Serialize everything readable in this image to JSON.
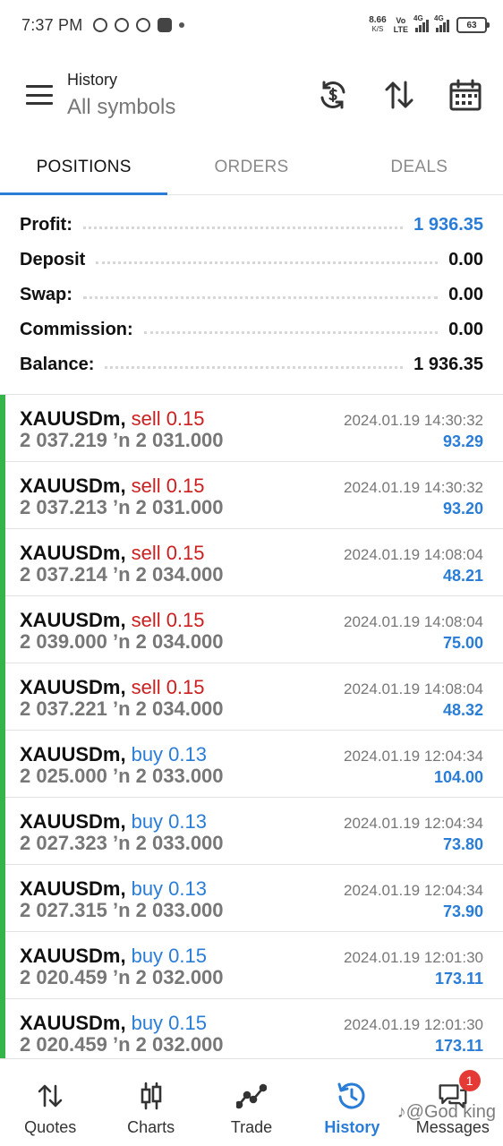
{
  "status_bar": {
    "time": "7:37 PM",
    "net_speed": "8.66",
    "net_speed_unit": "K/S",
    "volte_top": "Vo",
    "volte_bottom": "LTE",
    "sig1_label": "4G",
    "sig2_label": "4G",
    "battery": "63"
  },
  "header": {
    "title": "History",
    "subtitle": "All symbols",
    "icons": [
      "refresh-currency-icon",
      "sort-icon",
      "calendar-icon"
    ]
  },
  "tabs": [
    {
      "label": "POSITIONS",
      "active": true
    },
    {
      "label": "ORDERS",
      "active": false
    },
    {
      "label": "DEALS",
      "active": false
    }
  ],
  "summary": [
    {
      "label": "Profit:",
      "value": "1 936.35",
      "color": "#2a7dd6"
    },
    {
      "label": "Deposit",
      "value": "0.00"
    },
    {
      "label": "Swap:",
      "value": "0.00"
    },
    {
      "label": "Commission:",
      "value": "0.00"
    },
    {
      "label": "Balance:",
      "value": "1 936.35"
    }
  ],
  "positions": [
    {
      "symbol": "XAUUSDm,",
      "side": "sell 0.15",
      "type": "sell",
      "time": "2024.01.19 14:30:32",
      "prices": "2 037.219 ’n  2 031.000",
      "profit": "93.29"
    },
    {
      "symbol": "XAUUSDm,",
      "side": "sell 0.15",
      "type": "sell",
      "time": "2024.01.19 14:30:32",
      "prices": "2 037.213 ’n  2 031.000",
      "profit": "93.20"
    },
    {
      "symbol": "XAUUSDm,",
      "side": "sell 0.15",
      "type": "sell",
      "time": "2024.01.19 14:08:04",
      "prices": "2 037.214 ’n  2 034.000",
      "profit": "48.21"
    },
    {
      "symbol": "XAUUSDm,",
      "side": "sell 0.15",
      "type": "sell",
      "time": "2024.01.19 14:08:04",
      "prices": "2 039.000 ’n  2 034.000",
      "profit": "75.00"
    },
    {
      "symbol": "XAUUSDm,",
      "side": "sell 0.15",
      "type": "sell",
      "time": "2024.01.19 14:08:04",
      "prices": "2 037.221 ’n  2 034.000",
      "profit": "48.32"
    },
    {
      "symbol": "XAUUSDm,",
      "side": "buy 0.13",
      "type": "buy",
      "time": "2024.01.19 12:04:34",
      "prices": "2 025.000 ’n  2 033.000",
      "profit": "104.00"
    },
    {
      "symbol": "XAUUSDm,",
      "side": "buy 0.13",
      "type": "buy",
      "time": "2024.01.19 12:04:34",
      "prices": "2 027.323 ’n  2 033.000",
      "profit": "73.80"
    },
    {
      "symbol": "XAUUSDm,",
      "side": "buy 0.13",
      "type": "buy",
      "time": "2024.01.19 12:04:34",
      "prices": "2 027.315 ’n  2 033.000",
      "profit": "73.90"
    },
    {
      "symbol": "XAUUSDm,",
      "side": "buy 0.15",
      "type": "buy",
      "time": "2024.01.19 12:01:30",
      "prices": "2 020.459 ’n  2 032.000",
      "profit": "173.11"
    },
    {
      "symbol": "XAUUSDm,",
      "side": "buy 0.15",
      "type": "buy",
      "time": "2024.01.19 12:01:30",
      "prices": "2 020.459 ’n  2 032.000",
      "profit": "173.11"
    }
  ],
  "nav": [
    {
      "label": "Quotes",
      "icon": "quotes-icon",
      "active": false
    },
    {
      "label": "Charts",
      "icon": "charts-icon",
      "active": false
    },
    {
      "label": "Trade",
      "icon": "trade-icon",
      "active": false
    },
    {
      "label": "History",
      "icon": "history-icon",
      "active": true
    },
    {
      "label": "Messages",
      "icon": "messages-icon",
      "active": false,
      "badge": "1"
    }
  ],
  "watermark": "♪@God king",
  "colors": {
    "accent": "#2a7dd6",
    "sell": "#cc1f1f",
    "position_bar": "#35b44a",
    "badge": "#e53935"
  }
}
